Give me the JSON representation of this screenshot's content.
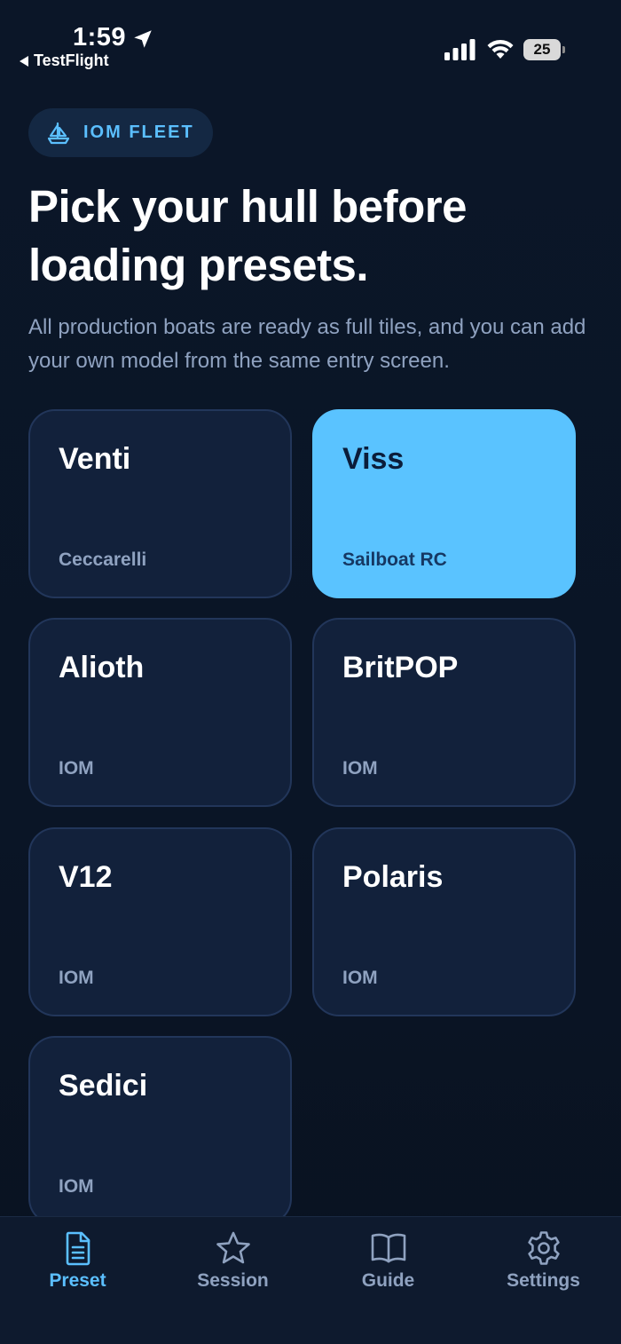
{
  "status_bar": {
    "time": "1:59",
    "back_app": "TestFlight",
    "battery": "25"
  },
  "badge": {
    "label": "IOM FLEET",
    "icon": "sailboat-icon"
  },
  "title": "Pick your hull before loading presets.",
  "subtitle": "All production boats are ready as full tiles, and you can add your own model from the same entry screen.",
  "tiles": [
    {
      "name": "Venti",
      "maker": "Ceccarelli",
      "selected": false
    },
    {
      "name": "Viss",
      "maker": "Sailboat RC",
      "selected": true
    },
    {
      "name": "Alioth",
      "maker": "IOM",
      "selected": false
    },
    {
      "name": "BritPOP",
      "maker": "IOM",
      "selected": false
    },
    {
      "name": "V12",
      "maker": "IOM",
      "selected": false
    },
    {
      "name": "Polaris",
      "maker": "IOM",
      "selected": false
    },
    {
      "name": "Sedici",
      "maker": "IOM",
      "selected": false
    }
  ],
  "tab_bar": {
    "tabs": [
      {
        "label": "Preset",
        "icon": "document-icon",
        "active": true
      },
      {
        "label": "Session",
        "icon": "star-icon",
        "active": false
      },
      {
        "label": "Guide",
        "icon": "book-icon",
        "active": false
      },
      {
        "label": "Settings",
        "icon": "gear-icon",
        "active": false
      }
    ]
  },
  "colors": {
    "accent": "#5bbfff",
    "background": "#0b1628",
    "tile": "#12213b",
    "tile_selected": "#5ac3ff"
  }
}
